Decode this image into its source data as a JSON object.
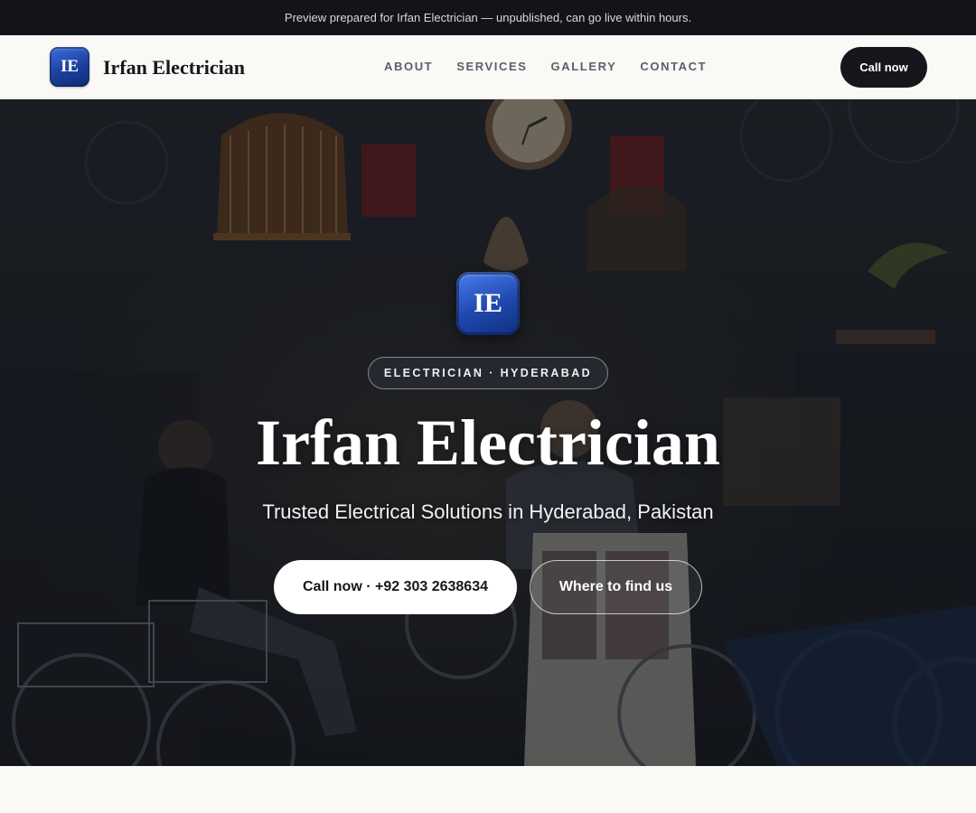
{
  "banner": {
    "text": "Preview prepared for Irfan Electrician — unpublished, can go live within hours."
  },
  "header": {
    "logo_initials": "IE",
    "brand_name": "Irfan Electrician",
    "nav": [
      {
        "label": "ABOUT"
      },
      {
        "label": "SERVICES"
      },
      {
        "label": "GALLERY"
      },
      {
        "label": "CONTACT"
      }
    ],
    "call_label": "Call now"
  },
  "hero": {
    "badge_initials": "IE",
    "tag": "ELECTRICIAN · HYDERABAD",
    "title": "Irfan Electrician",
    "subtitle": "Trusted Electrical Solutions in Hyderabad, Pakistan",
    "primary_button": "Call now · +92 303 2638634",
    "secondary_button": "Where to find us",
    "background_image": "shop-interior-photo"
  },
  "colors": {
    "topbar_bg": "#12141a",
    "page_bg": "#faf9f6",
    "dark_button": "#15171c",
    "badge_blue": "#1f47ad"
  }
}
